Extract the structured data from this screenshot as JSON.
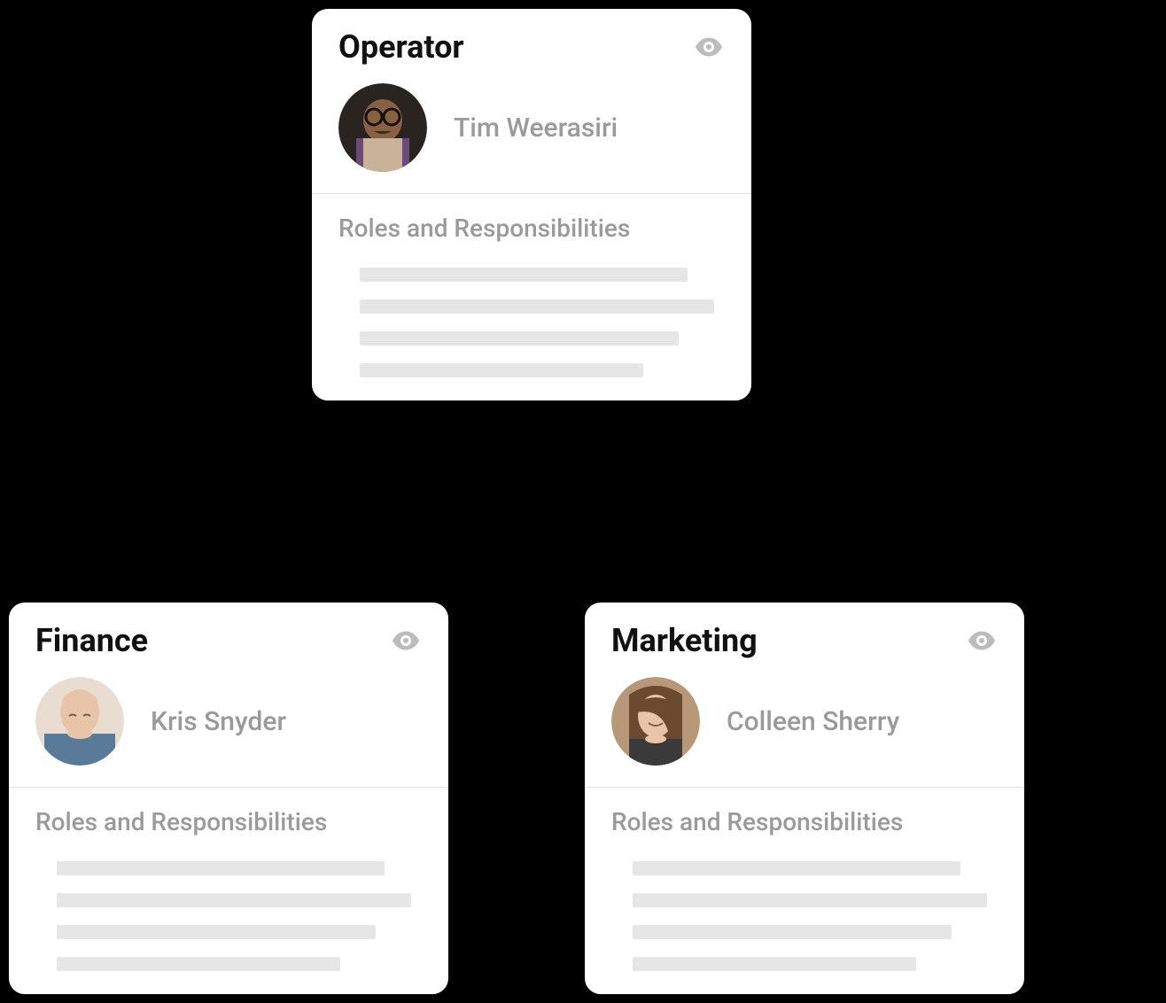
{
  "roles_heading": "Roles and Responsibilities",
  "cards": [
    {
      "title": "Operator",
      "person": "Tim Weerasiri"
    },
    {
      "title": "Finance",
      "person": "Kris Snyder"
    },
    {
      "title": "Marketing",
      "person": "Colleen Sherry"
    }
  ]
}
